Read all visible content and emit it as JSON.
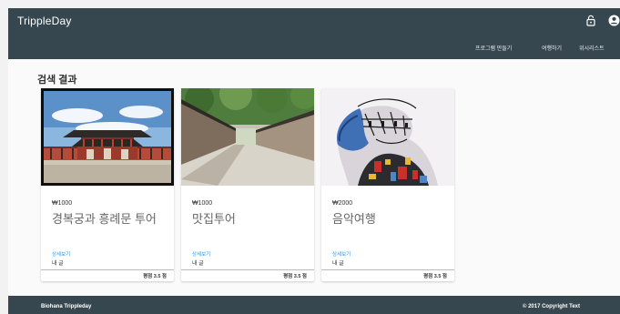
{
  "header": {
    "brand": "TrippleDay",
    "nav": [
      "프로그램 만들기",
      "여행하기",
      "위시리스트"
    ],
    "icons": [
      "lock-open-icon",
      "account-circle-icon"
    ]
  },
  "main": {
    "title": "검색 결과",
    "cards": [
      {
        "price": "₩1000",
        "title": "경복궁과 흥례문 투어",
        "detail_label": "상세보기",
        "owner_label": "내 글",
        "rating": "평점 3.5 점"
      },
      {
        "price": "₩1000",
        "title": "맛집투어",
        "detail_label": "상세보기",
        "owner_label": "내 글",
        "rating": "평점 3.5 점"
      },
      {
        "price": "₩2000",
        "title": "음악여행",
        "detail_label": "상세보기",
        "owner_label": "내 글",
        "rating": "평점 3.5 점"
      }
    ]
  },
  "footer": {
    "left": "Biohana Trippleday",
    "right": "© 2017 Copyright Text"
  },
  "colors": {
    "bar": "#37474f",
    "link": "#2196f3"
  }
}
